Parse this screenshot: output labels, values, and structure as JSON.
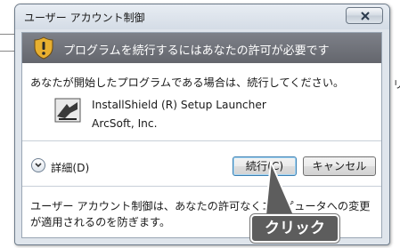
{
  "window": {
    "title": "ユーザー アカウント制御",
    "header": "プログラムを続行するにはあなたの許可が必要です"
  },
  "body": {
    "prompt": "あなたが開始したプログラムである場合は、続行してください。",
    "program_name": "InstallShield (R) Setup Launcher",
    "publisher": "ArcSoft, Inc."
  },
  "controls": {
    "details_label": "詳細(D)",
    "continue_label": "続行(C)",
    "cancel_label": "キャンセル"
  },
  "footer": {
    "text": "ユーザー アカウント制御は、あなたの許可なくコンピュータへの変更が適用されるのを防ぎます。"
  },
  "annotation": {
    "label": "クリック"
  },
  "background": {
    "fragment_right": "リ"
  },
  "colors": {
    "header_band": "#6e7078",
    "callout": "#5d5d5d",
    "default_button_border": "#3c7fb1"
  }
}
